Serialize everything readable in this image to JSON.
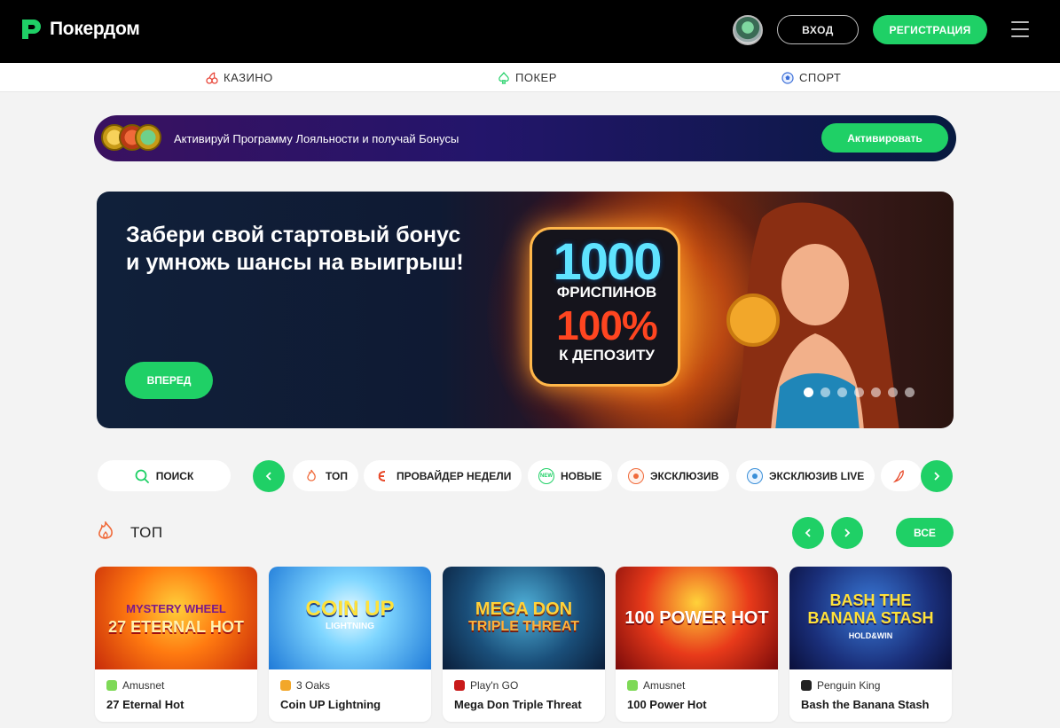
{
  "header": {
    "logo_text": "Покердом",
    "login_label": "ВХОД",
    "register_label": "РЕГИСТРАЦИЯ"
  },
  "section_nav": {
    "items": [
      {
        "label": "КАЗИНО",
        "icon": "cherries-icon"
      },
      {
        "label": "ПОКЕР",
        "icon": "spade-icon"
      },
      {
        "label": "СПОРТ",
        "icon": "soccer-ball-icon"
      }
    ]
  },
  "loyalty": {
    "text": "Активируй Программу Лояльности и получай Бонусы",
    "button_label": "Активировать"
  },
  "hero": {
    "title_line1": "Забери свой стартовый бонус",
    "title_line2": "и умножь шансы на выигрыш!",
    "button_label": "ВПЕРЕД",
    "promo_big": "1000",
    "promo_sub": "ФРИСПИНОВ",
    "promo_percent": "100%",
    "promo_sub2": "К ДЕПОЗИТУ",
    "slide_count": 7,
    "active_slide": 1
  },
  "filters": {
    "search_label": "ПОИСК",
    "chips": [
      {
        "label": "ТОП",
        "icon": "fire-icon"
      },
      {
        "label": "ПРОВАЙДЕР НЕДЕЛИ",
        "icon": "provider-icon"
      },
      {
        "label": "НОВЫЕ",
        "icon": "new-badge-icon"
      },
      {
        "label": "ЭКСКЛЮЗИВ",
        "icon": "exclusive-icon"
      },
      {
        "label": "ЭКСКЛЮЗИВ LIVE",
        "icon": "live-icon"
      }
    ]
  },
  "top_section": {
    "title": "ТОП",
    "all_label": "ВСЕ",
    "games": [
      {
        "provider": "Amusnet",
        "name": "27 Eternal Hot",
        "art_text": "27 ETERNAL HOT",
        "art_top": "MYSTERY WHEEL"
      },
      {
        "provider": "3 Oaks",
        "name": "Coin UP Lightning",
        "art_text": "COIN UP",
        "art_top": "LIGHTNING"
      },
      {
        "provider": "Play'n GO",
        "name": "Mega Don Triple Threat",
        "art_text": "MEGA DON",
        "art_top": "TRIPLE THREAT"
      },
      {
        "provider": "Amusnet",
        "name": "100 Power Hot",
        "art_text": "100 POWER HOT",
        "art_top": ""
      },
      {
        "provider": "Penguin King",
        "name": "Bash the Banana Stash",
        "art_text": "BASH THE BANANA STASH",
        "art_top": "HOLD&WIN"
      }
    ]
  },
  "colors": {
    "accent": "#1fd066",
    "header_bg": "#000000",
    "page_bg": "#f3f3f3"
  }
}
